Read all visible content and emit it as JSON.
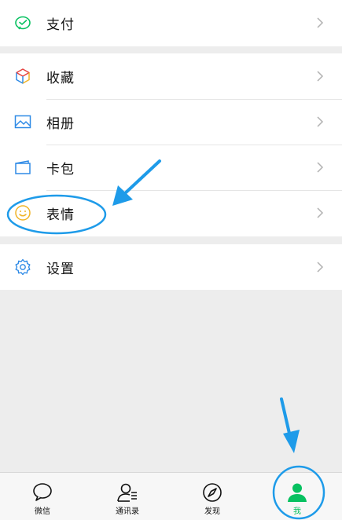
{
  "groups": [
    {
      "items": [
        {
          "label": "支付",
          "icon": "wechat-pay-icon"
        }
      ]
    },
    {
      "items": [
        {
          "label": "收藏",
          "icon": "favorites-cube-icon"
        },
        {
          "label": "相册",
          "icon": "album-photo-icon"
        },
        {
          "label": "卡包",
          "icon": "card-wallet-icon"
        },
        {
          "label": "表情",
          "icon": "sticker-smiley-icon"
        }
      ]
    },
    {
      "items": [
        {
          "label": "设置",
          "icon": "settings-gear-icon"
        }
      ]
    }
  ],
  "tabbar": {
    "tabs": [
      {
        "label": "微信",
        "icon": "chat-bubble-icon",
        "active": false
      },
      {
        "label": "通讯录",
        "icon": "contacts-icon",
        "active": false
      },
      {
        "label": "发现",
        "icon": "compass-icon",
        "active": false
      },
      {
        "label": "我",
        "icon": "me-person-icon",
        "active": true
      }
    ]
  },
  "colors": {
    "accent_green": "#07c160",
    "annotation_blue": "#1e9be9",
    "background": "#ededed"
  }
}
